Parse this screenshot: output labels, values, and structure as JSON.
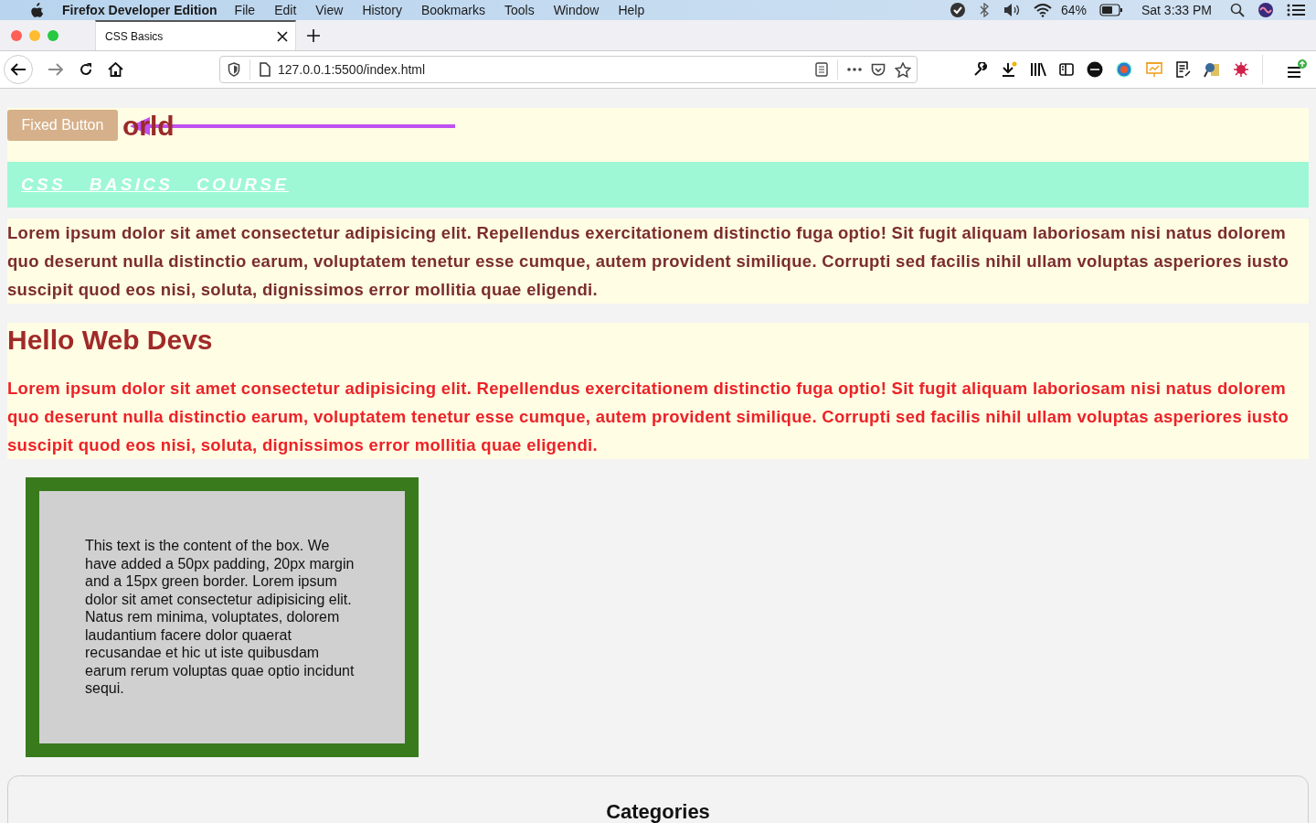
{
  "menu_bar": {
    "app_name": "Firefox Developer Edition",
    "menus": [
      "File",
      "Edit",
      "View",
      "History",
      "Bookmarks",
      "Tools",
      "Window",
      "Help"
    ],
    "battery": "64%",
    "clock": "Sat 3:33 PM"
  },
  "tabs": [
    {
      "label": "CSS Basics",
      "selected": true
    }
  ],
  "address_bar": {
    "url": "127.0.0.1:5500/index.html"
  },
  "page": {
    "fixed_button": "Fixed Button",
    "header_title": "orld",
    "course_banner": "CSS   BASICS   COURSE",
    "intro_paragraph": "Lorem ipsum dolor sit amet consectetur adipisicing elit. Repellendus exercitationem distinctio fuga optio! Sit fugit aliquam laboriosam nisi natus dolorem quo deserunt nulla distinctio earum, voluptatem tenetur esse cumque, autem provident similique. Corrupti sed facilis nihil ullam voluptas asperiores iusto suscipit quod eos nisi, soluta, dignissimos error mollitia quae eligendi.",
    "section_heading": "Hello Web Devs",
    "section_paragraph": "Lorem ipsum dolor sit amet consectetur adipisicing elit. Repellendus exercitationem distinctio fuga optio! Sit fugit aliquam laboriosam nisi natus dolorem quo deserunt nulla distinctio earum, voluptatem tenetur esse cumque, autem provident similique. Corrupti sed facilis nihil ullam voluptas asperiores iusto suscipit quod eos nisi, soluta, dignissimos error mollitia quae eligendi.",
    "box_text": "This text is the content of the box. We have added a 50px padding, 20px margin and a 15px green border. Lorem ipsum dolor sit amet consectetur adipisicing elit. Natus rem minima, voluptates, dolorem laudantium facere dolor quaerat recusandae et hic ut iste quibusdam earum rerum voluptas quae optio incidunt sequi.",
    "card_title": "Categories"
  }
}
